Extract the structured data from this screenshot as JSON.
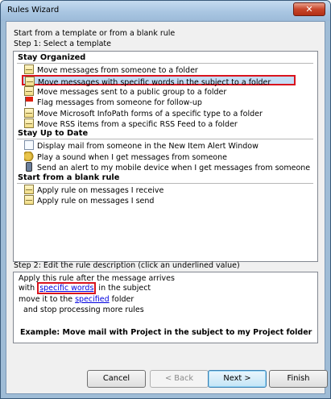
{
  "window": {
    "title": "Rules Wizard",
    "close_label": "✕"
  },
  "intro_text": "Start from a template or from a blank rule",
  "step1_label": "Step 1: Select a template",
  "templates": {
    "organized_header": "Stay Organized",
    "organized_items": [
      {
        "label": "Move messages from someone to a folder",
        "icon": "envelope-icon"
      },
      {
        "label": "Move messages with specific words in the subject to a folder",
        "icon": "envelope-icon",
        "selected": true
      },
      {
        "label": "Move messages sent to a public group to a folder",
        "icon": "envelope-icon"
      },
      {
        "label": "Flag messages from someone for follow-up",
        "icon": "flag-icon"
      },
      {
        "label": "Move Microsoft InfoPath forms of a specific type to a folder",
        "icon": "envelope-icon"
      },
      {
        "label": "Move RSS items from a specific RSS Feed to a folder",
        "icon": "envelope-icon"
      }
    ],
    "uptodate_header": "Stay Up to Date",
    "uptodate_items": [
      {
        "label": "Display mail from someone in the New Item Alert Window",
        "icon": "alert-window-icon"
      },
      {
        "label": "Play a sound when I get messages from someone",
        "icon": "speaker-icon"
      },
      {
        "label": "Send an alert to my mobile device when I get messages from someone",
        "icon": "mobile-phone-icon"
      }
    ],
    "blank_header": "Start from a blank rule",
    "blank_items": [
      {
        "label": "Apply rule on messages I receive",
        "icon": "envelope-icon"
      },
      {
        "label": "Apply rule on messages I send",
        "icon": "envelope-icon"
      }
    ]
  },
  "step2_label": "Step 2: Edit the rule description (click an underlined value)",
  "description": {
    "line1": "Apply this rule after the message arrives",
    "line2_prefix": "with ",
    "line2_link": "specific words",
    "line2_suffix": " in the subject",
    "line3_prefix": "move it to the ",
    "line3_link": "specified",
    "line3_suffix": " folder",
    "line4": "  and stop processing more rules",
    "example": "Example: Move mail with Project in the subject to my Project folder"
  },
  "buttons": {
    "cancel": "Cancel",
    "back": "< Back",
    "next": "Next >",
    "finish": "Finish"
  }
}
